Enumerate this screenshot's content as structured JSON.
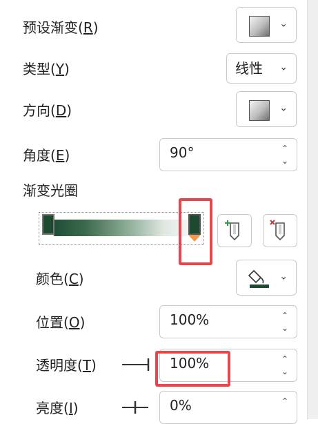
{
  "rows": {
    "preset": {
      "label": "预设渐变(",
      "key": "R",
      "close": ")"
    },
    "type": {
      "label": "类型(",
      "key": "Y",
      "close": ")",
      "value": "线性"
    },
    "direction": {
      "label": "方向(",
      "key": "D",
      "close": ")"
    },
    "angle": {
      "label": "角度(",
      "key": "E",
      "close": ")",
      "value": "90°"
    },
    "stops_title": "渐变光圈",
    "color": {
      "label": "颜色(",
      "key": "C",
      "close": ")"
    },
    "position": {
      "label": "位置(",
      "key": "O",
      "close": ")",
      "value": "100%"
    },
    "transparency": {
      "label": "透明度(",
      "key": "T",
      "close": ")",
      "value": "100%"
    },
    "brightness": {
      "label": "亮度(",
      "key": "I",
      "close": ")",
      "value": "0%"
    }
  },
  "icons": {
    "chevron": "⌄",
    "spin_up": "⌃",
    "spin_down": "⌄"
  },
  "colors": {
    "stop_color": "#1b4a2e",
    "highlight": "#e8454d",
    "paint_fill": "#1b4a2e"
  }
}
